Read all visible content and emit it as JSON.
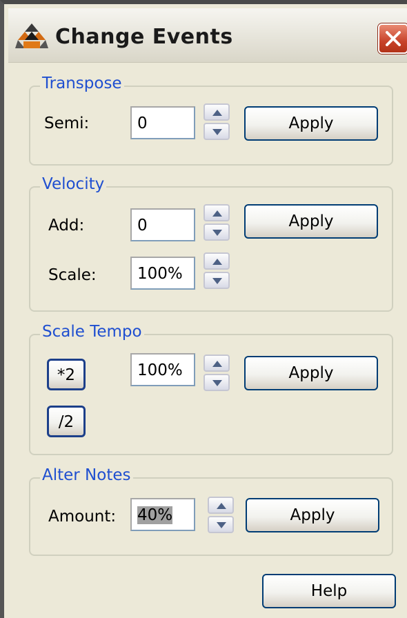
{
  "window": {
    "title": "Change Events",
    "app_icon": "reason-logo-icon",
    "close_icon": "close-x-icon"
  },
  "transpose": {
    "label": "Transpose",
    "semi_label": "Semi:",
    "semi_value": "0",
    "apply_label": "Apply"
  },
  "velocity": {
    "label": "Velocity",
    "add_label": "Add:",
    "add_value": "0",
    "scale_label": "Scale:",
    "scale_value": "100%",
    "apply_label": "Apply"
  },
  "scale_tempo": {
    "label": "Scale Tempo",
    "double_label": "*2",
    "half_label": "/2",
    "value": "100%",
    "apply_label": "Apply"
  },
  "alter_notes": {
    "label": "Alter Notes",
    "amount_label": "Amount:",
    "amount_value": "40%",
    "apply_label": "Apply"
  },
  "help_label": "Help",
  "colors": {
    "group_label": "#1f4fd0",
    "button_border": "#003c74",
    "close_red": "#c8432a"
  }
}
